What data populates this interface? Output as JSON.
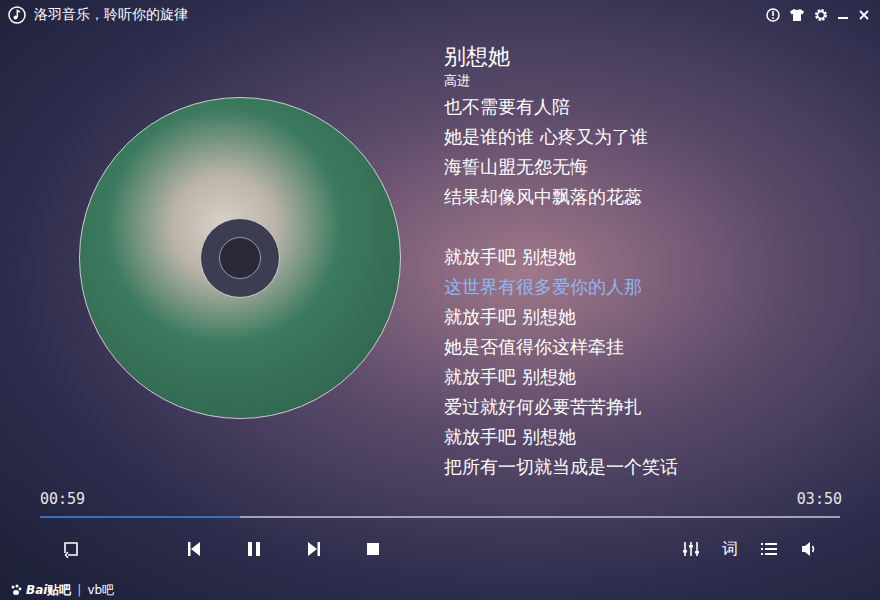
{
  "window": {
    "title": "洛羽音乐，聆听你的旋律"
  },
  "song": {
    "title": "别想她",
    "artist": "高进"
  },
  "lyrics": [
    {
      "text": "也不需要有人陪",
      "selected": false
    },
    {
      "text": "她是谁的谁  心疼又为了谁",
      "selected": false
    },
    {
      "text": "海誓山盟无怨无悔",
      "selected": false
    },
    {
      "text": "结果却像风中飘落的花蕊",
      "selected": false
    },
    {
      "text": "",
      "selected": false
    },
    {
      "text": "就放手吧  别想她",
      "selected": false
    },
    {
      "text": "这世界有很多爱你的人那",
      "selected": true
    },
    {
      "text": "就放手吧  别想她",
      "selected": false
    },
    {
      "text": "她是否值得你这样牵挂",
      "selected": false
    },
    {
      "text": "就放手吧  别想她",
      "selected": false
    },
    {
      "text": "爱过就好何必要苦苦挣扎",
      "selected": false
    },
    {
      "text": "就放手吧  别想她",
      "selected": false
    },
    {
      "text": "把所有一切就当成是一个笑话",
      "selected": false
    }
  ],
  "playback": {
    "elapsed": "00:59",
    "total": "03:50",
    "level": 0.25,
    "playing": true
  },
  "lyrics_button": "词",
  "watermark": {
    "brand": "Bai",
    "brand_suffix": "贴吧",
    "separator": "|",
    "board": "vb吧"
  }
}
